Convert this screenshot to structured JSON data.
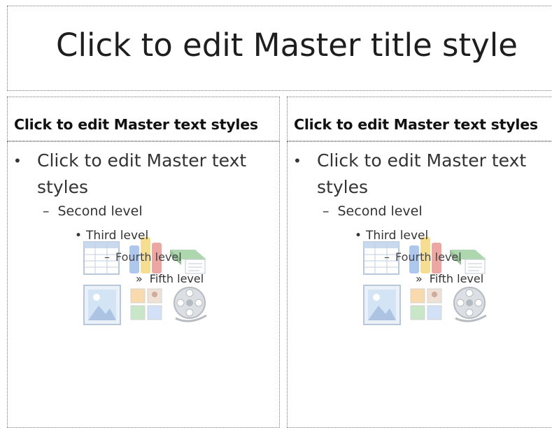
{
  "slide": {
    "title": "Click to edit Master title style",
    "columns": [
      {
        "heading": "Click to edit Master text styles",
        "levels": {
          "first": "Click to edit Master text styles",
          "second": "Second level",
          "third": "Third level",
          "fourth": "Fourth level",
          "fifth": "Fifth level"
        },
        "content_icons": [
          "table-icon",
          "chart-icon",
          "smartart-icon",
          "picture-icon",
          "clip-art-icon",
          "media-icon"
        ]
      },
      {
        "heading": "Click to edit Master text styles",
        "levels": {
          "first": "Click to edit Master text styles",
          "second": "Second level",
          "third": "Third level",
          "fourth": "Fourth level",
          "fifth": "Fifth level"
        },
        "content_icons": [
          "table-icon",
          "chart-icon",
          "smartart-icon",
          "picture-icon",
          "clip-art-icon",
          "media-icon"
        ]
      }
    ]
  },
  "colors": {
    "placeholder_border": "#7a7a7a",
    "title_text": "#1e1e1e",
    "body_text": "#333333"
  }
}
